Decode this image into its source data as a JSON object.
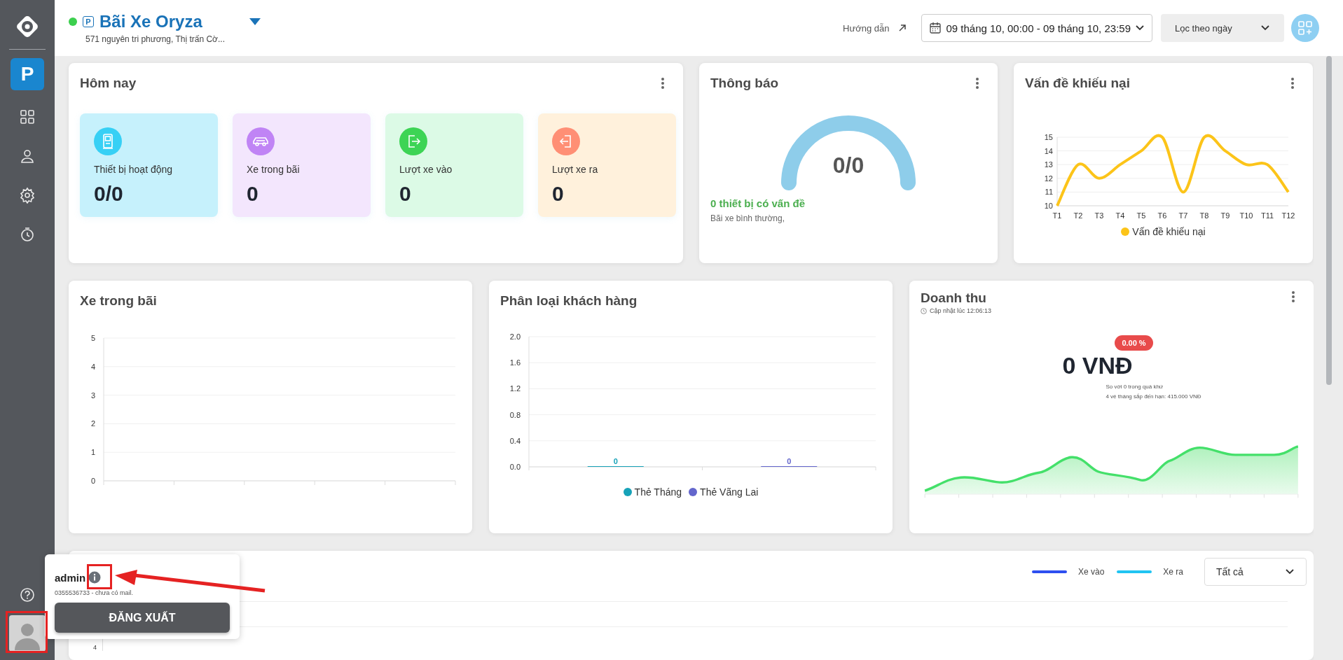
{
  "sidebar": {
    "items": [
      {
        "kind": "letter",
        "label": "P",
        "selected": true
      },
      {
        "kind": "grid",
        "selected": false
      },
      {
        "kind": "user",
        "selected": false
      },
      {
        "kind": "settings",
        "selected": false
      },
      {
        "kind": "timer",
        "selected": false
      }
    ]
  },
  "header": {
    "online": true,
    "badge": "P",
    "title": "Bãi Xe Oryza",
    "address": "571 nguyên tri phương, Thị trấn Cờ...",
    "guide": "Hướng dẫn",
    "date_range": "09 tháng 10, 00:00 - 09 tháng 10, 23:59",
    "filter": "Lọc theo ngày"
  },
  "today": {
    "title": "Hôm nay",
    "stats": [
      {
        "kind": "device",
        "label": "Thiết bị hoạt động",
        "value": "0/0"
      },
      {
        "kind": "car",
        "label": "Xe trong bãi",
        "value": "0"
      },
      {
        "kind": "entry",
        "label": "Lượt xe vào",
        "value": "0"
      },
      {
        "kind": "exit",
        "label": "Lượt xe ra",
        "value": "0"
      }
    ]
  },
  "notifications": {
    "title": "Thông báo",
    "value": "0/0",
    "issues": "0 thiết bị có vấn đề",
    "status": "Bãi xe bình thường,"
  },
  "complaints": {
    "title": "Vấn đề khiếu nại",
    "chart_data": {
      "type": "line",
      "grid": true,
      "categories": [
        "T1",
        "T2",
        "T3",
        "T4",
        "T5",
        "T6",
        "T7",
        "T8",
        "T9",
        "T10",
        "T11",
        "T12"
      ],
      "ylim": [
        10,
        15
      ],
      "yticks": [
        10,
        11,
        12,
        13,
        14,
        15
      ],
      "series": [
        {
          "name": "Vấn đề khiếu nại",
          "color": "#fcc419",
          "values": [
            10,
            13,
            12,
            13,
            14,
            15,
            11,
            15,
            14,
            13,
            13,
            11
          ]
        }
      ]
    }
  },
  "parked": {
    "title": "Xe trong bãi",
    "axis_labels": [
      "5",
      "4",
      "3",
      "2",
      "1",
      "0"
    ]
  },
  "customers": {
    "title": "Phân loại khách hàng",
    "chart_data": {
      "type": "bar",
      "grid": true,
      "stacked": true,
      "categories": [
        null,
        null
      ],
      "ylim": [
        0,
        2
      ],
      "yticks": [
        {
          "value": 0,
          "label": "0.0"
        },
        {
          "value": 0.4,
          "label": "0.4"
        },
        {
          "value": 0.8,
          "label": "0.8"
        },
        {
          "value": 1.2,
          "label": "1.2"
        },
        {
          "value": 1.6,
          "label": "1.6"
        },
        {
          "value": 2,
          "label": "2.0"
        }
      ],
      "data_labels": true,
      "series": [
        {
          "name": "Thẻ Tháng",
          "color": "#17a2b8",
          "values": [
            0,
            null
          ]
        },
        {
          "name": "Thẻ Vãng Lai",
          "color": "#6366cc",
          "values": [
            null,
            0
          ]
        }
      ]
    }
  },
  "revenue": {
    "title": "Doanh thu",
    "updated": "Cập nhật lúc 12:06:13",
    "change": "0.00 %",
    "amount": "0 VNĐ",
    "compare": "So với 0 trong quá khứ",
    "due": "4 vé tháng sắp đến hạn: 415.000 VNĐ"
  },
  "traffic": {
    "legend": [
      {
        "label": "Xe vào",
        "color": "#2d4ff0"
      },
      {
        "label": "Xe ra",
        "color": "#21c4f2"
      }
    ],
    "filter": "Tất cả",
    "axis_label": "4"
  },
  "account_popup": {
    "name": "admin",
    "contact": "0355536733 - chưa có mail.",
    "logout": "ĐĂNG XUẤT"
  }
}
